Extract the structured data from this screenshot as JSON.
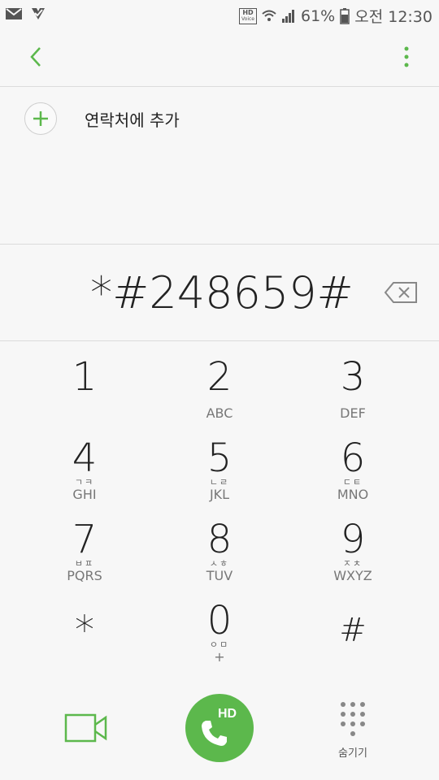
{
  "status_bar": {
    "hd_voice_top": "HD",
    "hd_voice_bottom": "Voice",
    "battery": "61%",
    "time": "오전 12:30"
  },
  "top_bar": {
    "back_icon": "chevron-left-icon",
    "more_icon": "more-vertical-icon"
  },
  "add_contact": {
    "label": "연락처에 추가"
  },
  "dialed_number": "*#248659#",
  "keypad": [
    {
      "digit": "1",
      "kor": "",
      "eng": ""
    },
    {
      "digit": "2",
      "kor": "",
      "eng": "ABC"
    },
    {
      "digit": "3",
      "kor": "",
      "eng": "DEF"
    },
    {
      "digit": "4",
      "kor": "ㄱㅋ",
      "eng": "GHI"
    },
    {
      "digit": "5",
      "kor": "ㄴㄹ",
      "eng": "JKL"
    },
    {
      "digit": "6",
      "kor": "ㄷㅌ",
      "eng": "MNO"
    },
    {
      "digit": "7",
      "kor": "ㅂㅍ",
      "eng": "PQRS"
    },
    {
      "digit": "8",
      "kor": "ㅅㅎ",
      "eng": "TUV"
    },
    {
      "digit": "9",
      "kor": "ㅈㅊ",
      "eng": "WXYZ"
    },
    {
      "digit": "*",
      "kor": "",
      "eng": ""
    },
    {
      "digit": "0",
      "kor": "ㅇㅁ",
      "eng": "+"
    },
    {
      "digit": "#",
      "kor": "",
      "eng": ""
    }
  ],
  "actions": {
    "call_badge": "HD",
    "hide_label": "숨기기"
  },
  "colors": {
    "accent": "#5cb84c",
    "background": "#f7f7f7"
  }
}
